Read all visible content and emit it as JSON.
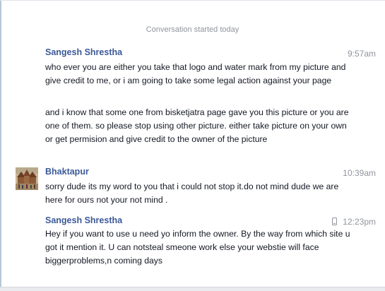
{
  "conversation": {
    "started_label": "Conversation started today"
  },
  "messages": [
    {
      "sender": "Sangesh Shrestha",
      "time": "9:57am",
      "paragraphs": [
        "who ever you are either you take that logo and water mark from my picture and give credit to me, or i am going to take some legal action against your page",
        "and i know that some one from bisketjatra page gave you this picture or you are one of them. so please stop using other picture. either take picture on your own or get permision and give credit to the owner of the picture"
      ]
    },
    {
      "sender": "Bhaktapur",
      "time": "10:39am",
      "avatar_icon": "bhaktapur-temple-avatar",
      "paragraphs": [
        "sorry dude its my word to you that i could not stop it.do not mind dude we are here for ours not your not mind ."
      ]
    },
    {
      "sender": "Sangesh Shrestha",
      "time": "12:23pm",
      "time_icon": "mobile-phone-icon",
      "paragraphs": [
        "Hey if you want to use u need yo inform the owner. By the way from which site u got it mention it. U can notsteal smeone work else your webstie will face biggerproblems,n coming days"
      ]
    }
  ],
  "colors": {
    "sender_link": "#3b5998",
    "meta_text": "#90949c",
    "body_text": "#141823"
  }
}
